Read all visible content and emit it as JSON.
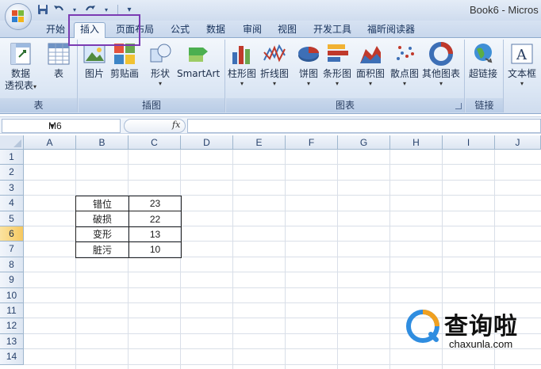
{
  "window": {
    "title": "Book6 - Micros"
  },
  "ribbon": {
    "tabs": [
      {
        "label": "开始",
        "active": false
      },
      {
        "label": "插入",
        "active": true
      },
      {
        "label": "页面布局",
        "active": false
      },
      {
        "label": "公式",
        "active": false
      },
      {
        "label": "数据",
        "active": false
      },
      {
        "label": "审阅",
        "active": false
      },
      {
        "label": "视图",
        "active": false
      },
      {
        "label": "开发工具",
        "active": false
      },
      {
        "label": "福昕阅读器",
        "active": false
      }
    ],
    "groups": {
      "table": {
        "label": "表",
        "buttons": [
          "数据",
          "透视表",
          "表"
        ]
      },
      "illustrations": {
        "label": "插图",
        "buttons": [
          "图片",
          "剪贴画",
          "形状",
          "SmartArt"
        ]
      },
      "charts": {
        "label": "图表",
        "buttons": [
          "柱形图",
          "折线图",
          "饼图",
          "条形图",
          "面积图",
          "散点图",
          "其他图表"
        ]
      },
      "links": {
        "label": "链接",
        "buttons": [
          "超链接"
        ]
      },
      "text": {
        "buttons": [
          "文本框"
        ]
      }
    }
  },
  "formula_bar": {
    "name_box": "M6",
    "fx": "fx",
    "value": ""
  },
  "sheet": {
    "columns": [
      "A",
      "B",
      "C",
      "D",
      "E",
      "F",
      "G",
      "H",
      "I",
      "J"
    ],
    "rows": [
      "1",
      "2",
      "3",
      "4",
      "5",
      "6",
      "7",
      "8",
      "9",
      "10",
      "11",
      "12",
      "13",
      "14"
    ],
    "selected_row": "6",
    "table": [
      {
        "name": "错位",
        "value": "23"
      },
      {
        "name": "破损",
        "value": "22"
      },
      {
        "name": "变形",
        "value": "13"
      },
      {
        "name": "脏污",
        "value": "10"
      }
    ]
  },
  "watermark": {
    "text": "查询啦",
    "url": "chaxunla.com"
  },
  "colors": {
    "accent": "#7b3bb3",
    "ribbon": "#dbe6f4",
    "selected_header": "#f6c860"
  }
}
